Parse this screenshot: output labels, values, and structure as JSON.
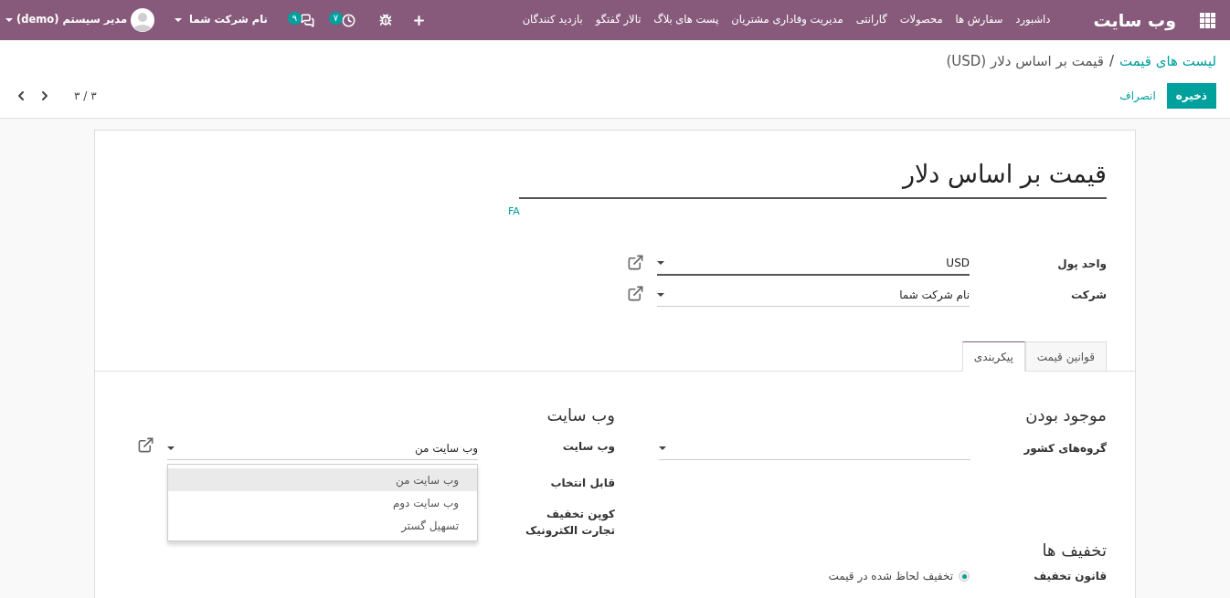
{
  "navbar": {
    "brand": "وب سایت",
    "menu": [
      "داشبورد",
      "سفارش ها",
      "محصولات",
      "گارانتی",
      "مدیریت وفاداری مشتریان",
      "پست های بلاگ",
      "تالار گفتگو",
      "بازدید کنندگان"
    ],
    "badges": [
      {
        "kind": "activity",
        "count": "۷"
      },
      {
        "kind": "messages",
        "count": "۹"
      }
    ],
    "company": "نام شرکت شما",
    "user": "مدیر سیستم (demo)"
  },
  "breadcrumb_separator": "/",
  "breadcrumb": [
    {
      "kind": "link",
      "label": "لیست های قیمت"
    },
    {
      "kind": "current",
      "label": "قیمت بر اساس دلار (USD)"
    }
  ],
  "buttons": {
    "save": "ذخیره",
    "discard": "انصراف"
  },
  "pager": "۳ / ۳",
  "form": {
    "title": "قیمت بر اساس دلار",
    "language": "FA",
    "fields": [
      {
        "label": "واحد پول",
        "value": "USD",
        "focused": true
      },
      {
        "label": "شرکت",
        "value": "نام شرکت شما",
        "focused": false
      }
    ]
  },
  "tabs": [
    {
      "label": "قوانین قیمت",
      "selected": false
    },
    {
      "label": "پیکربندی",
      "selected": true
    }
  ],
  "availability": {
    "heading": "موجود بودن",
    "fields": [
      {
        "kind": "select",
        "label": "گروه‌های کشور"
      }
    ]
  },
  "website_section": {
    "heading": "وب سایت",
    "fields": [
      {
        "kind": "select",
        "label": "وب سایت",
        "value": "وب سایت من",
        "dropdown": [
          {
            "label": "وب سایت من",
            "selected": true
          },
          {
            "label": "وب سایت دوم",
            "selected": false
          },
          {
            "label": "تسهیل گستر",
            "selected": false
          }
        ]
      },
      {
        "kind": "label",
        "label": "قابل انتخاب"
      },
      {
        "kind": "label",
        "label": "کوپن تخفیف تجارت الکترونیک"
      }
    ]
  },
  "discounts": {
    "heading": "تخفیف ها",
    "fields": [
      {
        "kind": "radio",
        "label": "قانون تخفیف",
        "options": [
          {
            "label": "تخفیف لحاظ شده در قیمت",
            "selected": true
          }
        ]
      }
    ]
  }
}
